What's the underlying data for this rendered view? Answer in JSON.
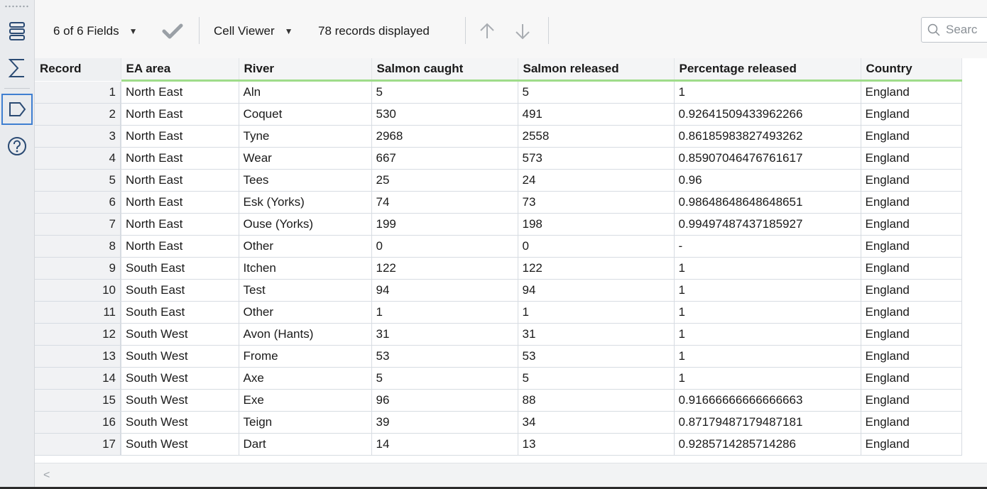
{
  "toolbar": {
    "fields_label": "6 of 6 Fields",
    "viewer_label": "Cell Viewer",
    "records_label": "78 records displayed",
    "search_placeholder": "Searc"
  },
  "rail": {
    "icons": [
      "list-icon",
      "sigma-icon",
      "tag-icon",
      "help-icon"
    ]
  },
  "table": {
    "columns": [
      "Record",
      "EA area",
      "River",
      "Salmon caught",
      "Salmon released",
      "Percentage released",
      "Country"
    ],
    "rows": [
      [
        "1",
        "North East",
        "Aln",
        "5",
        "5",
        "1",
        "England"
      ],
      [
        "2",
        "North East",
        "Coquet",
        "530",
        "491",
        "0.92641509433962266",
        "England"
      ],
      [
        "3",
        "North East",
        "Tyne",
        "2968",
        "2558",
        "0.86185983827493262",
        "England"
      ],
      [
        "4",
        "North East",
        "Wear",
        "667",
        "573",
        "0.85907046476761617",
        "England"
      ],
      [
        "5",
        "North East",
        "Tees",
        "25",
        "24",
        "0.96",
        "England"
      ],
      [
        "6",
        "North East",
        "Esk (Yorks)",
        "74",
        "73",
        "0.98648648648648651",
        "England"
      ],
      [
        "7",
        "North East",
        "Ouse (Yorks)",
        "199",
        "198",
        "0.99497487437185927",
        "England"
      ],
      [
        "8",
        "North East",
        "Other",
        "0",
        "0",
        "-",
        "England"
      ],
      [
        "9",
        "South East",
        "Itchen",
        "122",
        "122",
        "1",
        "England"
      ],
      [
        "10",
        "South East",
        "Test",
        "94",
        "94",
        "1",
        "England"
      ],
      [
        "11",
        "South East",
        "Other",
        "1",
        "1",
        "1",
        "England"
      ],
      [
        "12",
        "South West",
        "Avon (Hants)",
        "31",
        "31",
        "1",
        "England"
      ],
      [
        "13",
        "South West",
        "Frome",
        "53",
        "53",
        "1",
        "England"
      ],
      [
        "14",
        "South West",
        "Axe",
        "5",
        "5",
        "1",
        "England"
      ],
      [
        "15",
        "South West",
        "Exe",
        "96",
        "88",
        "0.91666666666666663",
        "England"
      ],
      [
        "16",
        "South West",
        "Teign",
        "39",
        "34",
        "0.87179487179487181",
        "England"
      ],
      [
        "17",
        "South West",
        "Dart",
        "14",
        "13",
        "0.9285714285714286",
        "England"
      ]
    ]
  },
  "colors": {
    "header_underline": "#9fdc8a",
    "active_rail": "#3f7fd1"
  }
}
